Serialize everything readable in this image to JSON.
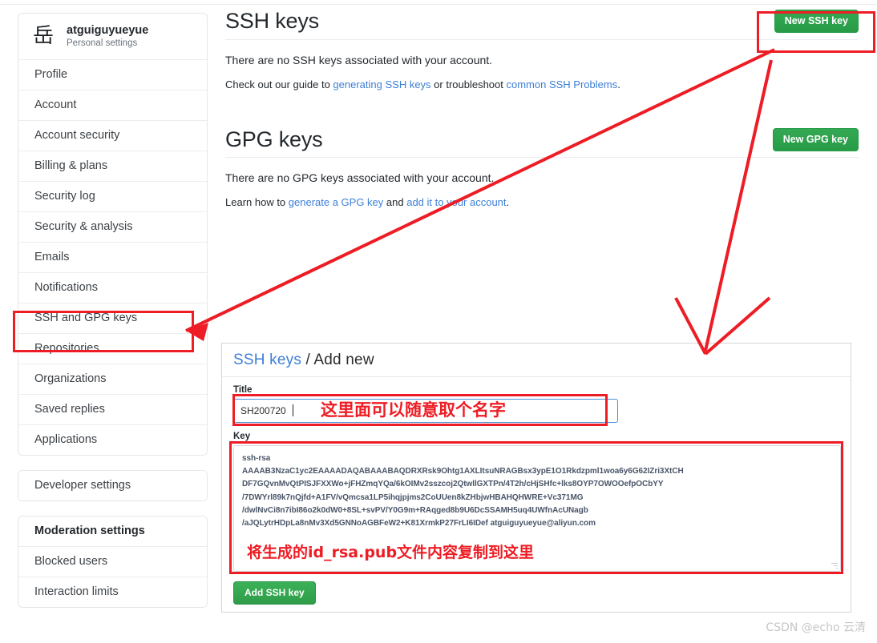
{
  "sidebar": {
    "account": {
      "avatar_glyph": "岳",
      "username": "atguiguyueyue",
      "subtitle": "Personal settings"
    },
    "group1": [
      {
        "label": "Profile"
      },
      {
        "label": "Account"
      },
      {
        "label": "Account security"
      },
      {
        "label": "Billing & plans"
      },
      {
        "label": "Security log"
      },
      {
        "label": "Security & analysis"
      },
      {
        "label": "Emails"
      },
      {
        "label": "Notifications"
      },
      {
        "label": "SSH and GPG keys"
      },
      {
        "label": "Repositories"
      },
      {
        "label": "Organizations"
      },
      {
        "label": "Saved replies"
      },
      {
        "label": "Applications"
      }
    ],
    "group2": [
      {
        "label": "Developer settings"
      }
    ],
    "group3": [
      {
        "label": "Moderation settings"
      },
      {
        "label": "Blocked users"
      },
      {
        "label": "Interaction limits"
      }
    ]
  },
  "ssh_section": {
    "title": "SSH keys",
    "button": "New SSH key",
    "empty_text": "There are no SSH keys associated with your account.",
    "help_prefix": "Check out our guide to ",
    "help_link1": "generating SSH keys",
    "help_middle": " or troubleshoot ",
    "help_link2": "common SSH Problems",
    "help_suffix": "."
  },
  "gpg_section": {
    "title": "GPG keys",
    "button": "New GPG key",
    "empty_text": "There are no GPG keys associated with your account.",
    "help_prefix": "Learn how to ",
    "help_link1": "generate a GPG key",
    "help_middle": " and ",
    "help_link2": "add it to your account",
    "help_suffix": "."
  },
  "add_new_panel": {
    "breadcrumb_link": "SSH keys",
    "breadcrumb_sep": " / ",
    "breadcrumb_current": "Add new",
    "title_label": "Title",
    "title_value": "SH200720",
    "key_label": "Key",
    "key_value": "ssh-rsa\nAAAAB3NzaC1yc2EAAAADAQABAAABAQDRXRsk9Ohtg1AXLItsuNRAGBsx3ypE1O1Rkdzpml1woa6y6G62IZri3XtCH\nDF7GQvnMvQtPISJFXXWo+jFHZmqYQa/6kOIMv2sszcoj2QtwllGXTPn/4T2h/cHjSHfc+lks8OYP7OWOOefpOCbYY\n/7DWYrl89k7nQjfd+A1FV/vQmcsa1LP5ihqjpjms2CoUUen8kZHbjwHBAHQHWRE+Vc371MG\n/dwlNvCi8n7ibI86o2k0dW0+8SL+svPV/Y0G9m+RAqged8b9U6DcSSAMH5uq4UWfnAcUNagb\n/aJQLytrHDpLa8nMv3Xd5GNNoAGBFeW2+K81XrmkP27FrLI6IDef atguiguyueyue@aliyun.com",
    "submit_button": "Add SSH key"
  },
  "annotations": {
    "title_note": "这里面可以随意取个名字",
    "key_note": "将生成的id_rsa.pub文件内容复制到这里",
    "accent_color": "#ee1c24"
  },
  "watermark": "CSDN @echo 云清"
}
